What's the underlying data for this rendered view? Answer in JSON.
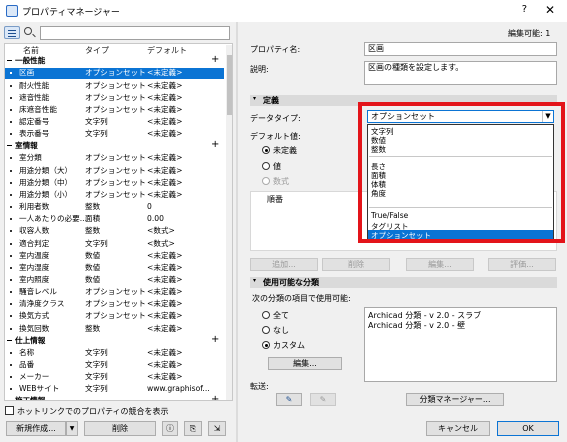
{
  "window": {
    "title": "プロパティマネージャー",
    "help": "?",
    "close": "✕"
  },
  "left": {
    "search_placeholder": "",
    "columns": [
      "名前",
      "タイプ",
      "デフォルト"
    ],
    "rows": [
      {
        "kind": "group",
        "name": "一般性能"
      },
      {
        "kind": "item",
        "name": "区画",
        "type": "オプションセット",
        "def": "<未定義>",
        "selected": true
      },
      {
        "kind": "item",
        "name": "耐火性能",
        "type": "オプションセット",
        "def": "<未定義>"
      },
      {
        "kind": "item",
        "name": "遮音性能",
        "type": "オプションセット",
        "def": "<未定義>"
      },
      {
        "kind": "item",
        "name": "床遮音性能",
        "type": "オプションセット",
        "def": "<未定義>"
      },
      {
        "kind": "item",
        "name": "認定番号",
        "type": "文字列",
        "def": "<未定義>"
      },
      {
        "kind": "item",
        "name": "表示番号",
        "type": "文字列",
        "def": "<未定義>"
      },
      {
        "kind": "group",
        "name": "室情報"
      },
      {
        "kind": "item",
        "name": "室分類",
        "type": "オプションセット",
        "def": "<未定義>"
      },
      {
        "kind": "item",
        "name": "用途分類（大）",
        "type": "オプションセット",
        "def": "<未定義>"
      },
      {
        "kind": "item",
        "name": "用途分類（中）",
        "type": "オプションセット",
        "def": "<未定義>"
      },
      {
        "kind": "item",
        "name": "用途分類（小）",
        "type": "オプションセット",
        "def": "<未定義>"
      },
      {
        "kind": "item",
        "name": "利用者数",
        "type": "整数",
        "def": "0"
      },
      {
        "kind": "item",
        "name": "一人あたりの必要...",
        "type": "面積",
        "def": "0.00"
      },
      {
        "kind": "item",
        "name": "収容人数",
        "type": "整数",
        "def": "<数式>"
      },
      {
        "kind": "item",
        "name": "適合判定",
        "type": "文字列",
        "def": "<数式>"
      },
      {
        "kind": "item",
        "name": "室内温度",
        "type": "数値",
        "def": "<未定義>"
      },
      {
        "kind": "item",
        "name": "室内湿度",
        "type": "数値",
        "def": "<未定義>"
      },
      {
        "kind": "item",
        "name": "室内照度",
        "type": "数値",
        "def": "<未定義>"
      },
      {
        "kind": "item",
        "name": "騒音レベル",
        "type": "オプションセット",
        "def": "<未定義>"
      },
      {
        "kind": "item",
        "name": "清浄度クラス",
        "type": "オプションセット",
        "def": "<未定義>"
      },
      {
        "kind": "item",
        "name": "換気方式",
        "type": "オプションセット",
        "def": "<未定義>"
      },
      {
        "kind": "item",
        "name": "換気回数",
        "type": "整数",
        "def": "<未定義>"
      },
      {
        "kind": "group",
        "name": "仕上情報"
      },
      {
        "kind": "item",
        "name": "名称",
        "type": "文字列",
        "def": "<未定義>"
      },
      {
        "kind": "item",
        "name": "品番",
        "type": "文字列",
        "def": "<未定義>"
      },
      {
        "kind": "item",
        "name": "メーカー",
        "type": "文字列",
        "def": "<未定義>"
      },
      {
        "kind": "item",
        "name": "WEBサイト",
        "type": "文字列",
        "def": "www.graphisof..."
      },
      {
        "kind": "group",
        "name": "施工情報"
      }
    ],
    "hotlink_label": "ホットリンクでのプロパティの競合を表示",
    "new_button": "新規作成...",
    "delete_button": "削除"
  },
  "right": {
    "editable": "編集可能: 1",
    "name_label": "プロパティ名:",
    "name_value": "区画",
    "desc_label": "説明:",
    "desc_value": "区画の種類を設定します。",
    "definition_header": "定義",
    "datatype_label": "データタイプ:",
    "datatype_value": "オプションセット",
    "default_label": "デフォルト値:",
    "opt_undefined": "未定義",
    "opt_value": "値",
    "opt_formula": "数式",
    "order_label": "順番",
    "add_btn": "追加...",
    "delete_btn": "削除",
    "edit_btn": "編集...",
    "eval_btn": "評価...",
    "classification_header": "使用可能な分類",
    "usage_label": "次の分類の項目で使用可能:",
    "opt_all": "全て",
    "opt_none": "なし",
    "opt_custom": "カスタム",
    "class_items": [
      "Archicad 分類 - v 2.0 - スラブ",
      "Archicad 分類 - v 2.0 - 壁"
    ],
    "edit_class_btn": "編集...",
    "transfer_label": "転送:",
    "class_manager_btn": "分類マネージャー...",
    "cancel_btn": "キャンセル",
    "ok_btn": "OK",
    "dropdown_items": [
      "文字列",
      "数値",
      "整数",
      "長さ",
      "面積",
      "体積",
      "角度",
      "True/False",
      "タグリスト",
      "オプションセット"
    ]
  }
}
